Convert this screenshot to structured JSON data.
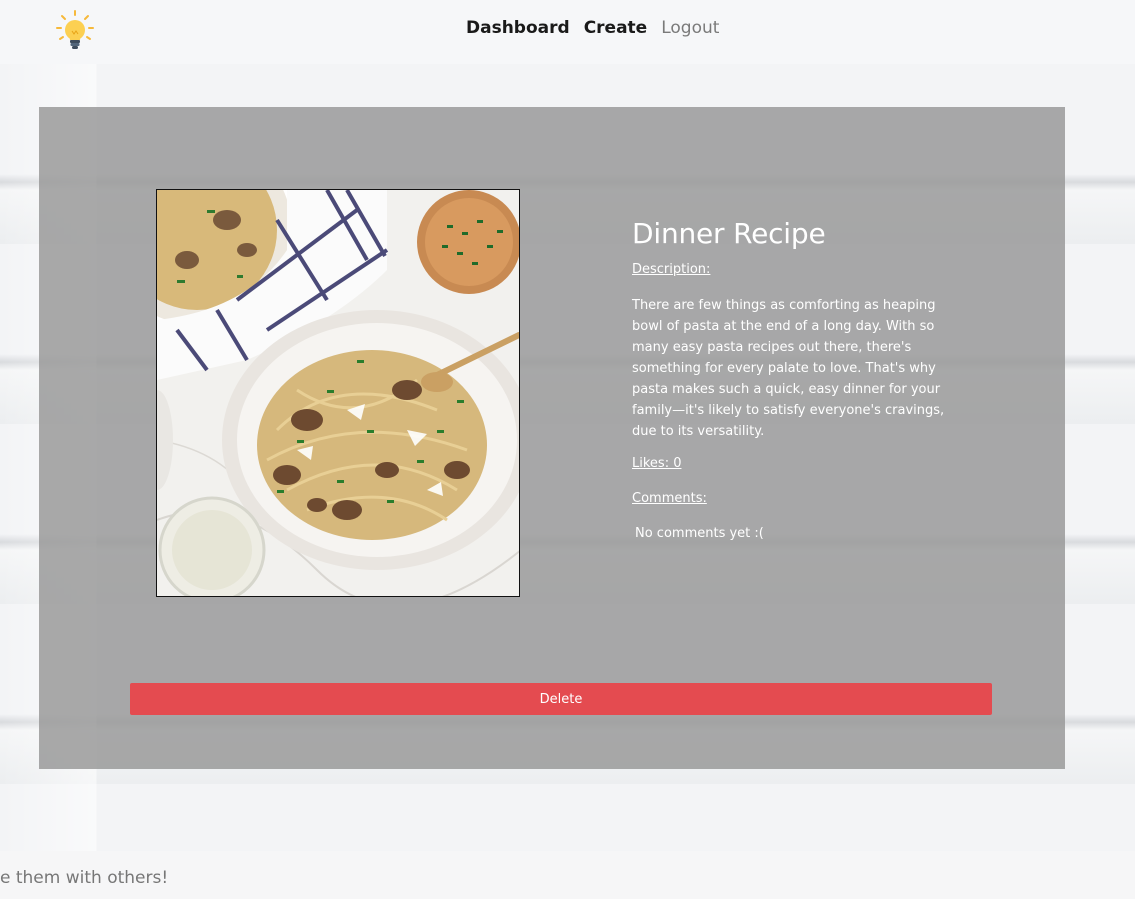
{
  "nav": {
    "logo_icon": "lightbulb-icon",
    "links": [
      {
        "label": "Dashboard"
      },
      {
        "label": "Create"
      },
      {
        "label": "Logout"
      }
    ]
  },
  "recipe": {
    "title": "Dinner Recipe",
    "description_label": "Description:",
    "description": "There are few things as comforting as heaping bowl of pasta at the end of a long day. With so many easy pasta recipes out there, there's something for every palate to love. That's why pasta makes such a quick, easy dinner for your family—it's likely to satisfy everyone's cravings, due to its versatility.",
    "likes_label": "Likes: 0",
    "comments_label": "Comments:",
    "no_comments": "No comments yet :(",
    "image_icon": "pasta-bowl-photo"
  },
  "actions": {
    "delete_label": "Delete"
  },
  "footer": {
    "text": "e them with others!"
  },
  "colors": {
    "delete": "#e44b50",
    "card_overlay": "#969696",
    "nav_bg": "#f6f7f9"
  }
}
